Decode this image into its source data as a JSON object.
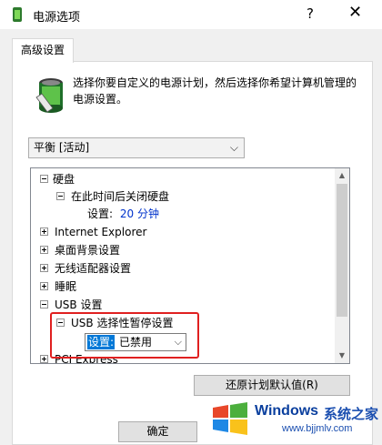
{
  "window": {
    "title": "电源选项",
    "help_glyph": "?",
    "close_glyph": "✕"
  },
  "tab": {
    "label": "高级设置"
  },
  "description": "选择你要自定义的电源计划，然后选择你希望计算机管理的电源设置。",
  "plan_select": {
    "value": "平衡 [活动]",
    "arrow": "⌵"
  },
  "tree": {
    "items": [
      {
        "label": "硬盘",
        "expanded": true
      },
      {
        "label": "在此时间后关闭硬盘",
        "expanded": true
      },
      {
        "setting_label": "设置:",
        "setting_value": "20 分钟"
      },
      {
        "label": "Internet Explorer",
        "expanded": false
      },
      {
        "label": "桌面背景设置",
        "expanded": false
      },
      {
        "label": "无线适配器设置",
        "expanded": false
      },
      {
        "label": "睡眠",
        "expanded": false
      },
      {
        "label": "USB 设置",
        "expanded": true
      },
      {
        "label": "USB 选择性暂停设置",
        "expanded": true
      },
      {
        "label": "PCI Express",
        "expanded": false
      }
    ],
    "inline_combo": {
      "label": "设置:",
      "value": "已禁用",
      "arrow": "⌵"
    }
  },
  "scrollbar": {
    "up": "▲",
    "down": "▼"
  },
  "buttons": {
    "restore": "还原计划默认值(R)",
    "ok": "确定"
  },
  "watermark": {
    "title": "Windows",
    "cn": "系统之家",
    "url": "www.bjjmlv.com"
  },
  "colors": {
    "accent": "#0078d7",
    "highlight_box": "#e02020",
    "setting_value": "#0033cc"
  }
}
